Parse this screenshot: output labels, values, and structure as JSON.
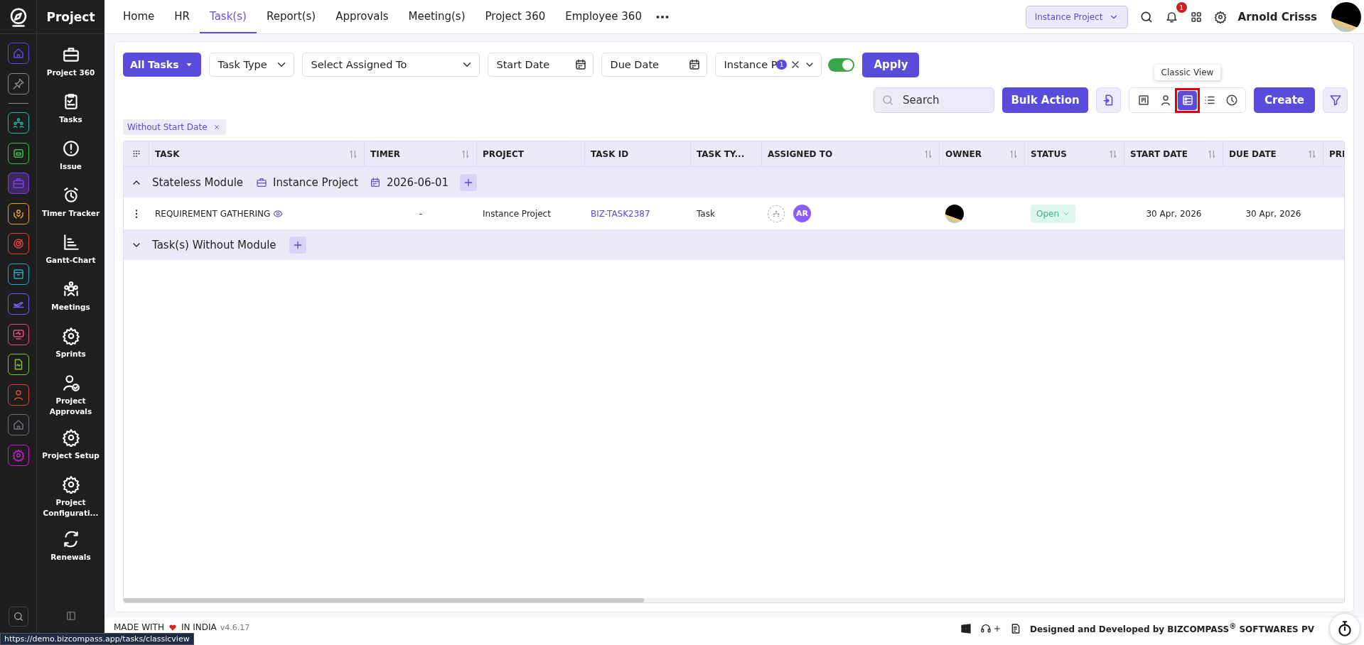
{
  "rail": {
    "items": [
      {
        "color": "#5b4bdb",
        "selected": false
      },
      {
        "color": "#8a8a8a",
        "selected": false
      },
      {
        "color": "#2bb5a5",
        "selected": false
      },
      {
        "color": "#3dbb4a",
        "selected": false
      },
      {
        "color": "#7b3fe4",
        "selected": true
      },
      {
        "color": "#e8a020",
        "selected": false
      },
      {
        "color": "#e0403a",
        "selected": false
      },
      {
        "color": "#2aa8c8",
        "selected": false
      },
      {
        "color": "#7b5cf0",
        "selected": false
      },
      {
        "color": "#e04b7a",
        "selected": false
      },
      {
        "color": "#7cc23a",
        "selected": false
      },
      {
        "color": "#e0453a",
        "selected": false
      },
      {
        "color": "#6a6f80",
        "selected": false
      },
      {
        "color": "#c020c0",
        "selected": false
      }
    ]
  },
  "sidebar": {
    "title": "Project",
    "items": [
      {
        "label": "Project 360"
      },
      {
        "label": "Tasks"
      },
      {
        "label": "Issue"
      },
      {
        "label": "Timer Tracker"
      },
      {
        "label": "Gantt-Chart"
      },
      {
        "label": "Meetings"
      },
      {
        "label": "Sprints"
      },
      {
        "label": "Project Approvals"
      },
      {
        "label": "Project Setup"
      },
      {
        "label": "Project Configurati..."
      },
      {
        "label": "Renewals"
      }
    ]
  },
  "nav": {
    "tabs": [
      {
        "label": "Home",
        "selected": false
      },
      {
        "label": "HR",
        "selected": false
      },
      {
        "label": "Task(s)",
        "selected": true
      },
      {
        "label": "Report(s)",
        "selected": false
      },
      {
        "label": "Approvals",
        "selected": false
      },
      {
        "label": "Meeting(s)",
        "selected": false
      },
      {
        "label": "Project 360",
        "selected": false
      },
      {
        "label": "Employee 360",
        "selected": false
      }
    ],
    "project": "Instance Project",
    "notifications": "1",
    "user": "Arnold Crisss"
  },
  "filters": {
    "all_tasks": "All Tasks",
    "task_type": "Task Type",
    "assigned_to": "Select Assigned To",
    "start_date": "Start Date",
    "due_date": "Due Date",
    "project": "Instance P",
    "project_count": "1",
    "toggle_on": true,
    "apply": "Apply"
  },
  "toolbar": {
    "search": {
      "placeholder": "Search"
    },
    "bulk_action": "Bulk Action",
    "views": [
      {
        "kind": "board",
        "selected": false
      },
      {
        "kind": "user",
        "selected": false
      },
      {
        "kind": "classic",
        "selected": true
      },
      {
        "kind": "list",
        "selected": false
      },
      {
        "kind": "clock",
        "selected": false
      }
    ],
    "tooltip": "Classic View",
    "create": "Create"
  },
  "chips": [
    {
      "label": "Without Start Date"
    }
  ],
  "table": {
    "columns": [
      {
        "label": "TASK",
        "sortable": true
      },
      {
        "label": "TIMER",
        "sortable": true
      },
      {
        "label": "PROJECT",
        "sortable": false
      },
      {
        "label": "TASK ID",
        "sortable": false
      },
      {
        "label": "TASK TY...",
        "sortable": false
      },
      {
        "label": "ASSIGNED TO",
        "sortable": true
      },
      {
        "label": "OWNER",
        "sortable": true
      },
      {
        "label": "STATUS",
        "sortable": true
      },
      {
        "label": "START DATE",
        "sortable": true
      },
      {
        "label": "DUE DATE",
        "sortable": true
      },
      {
        "label": "PRI",
        "sortable": false
      }
    ],
    "groups": [
      {
        "name": "Stateless Module",
        "expanded": true,
        "project": "Instance Project",
        "date": "2026-06-01",
        "rows": [
          {
            "task": "REQUIREMENT GATHERING",
            "timer": "-",
            "project": "Instance Project",
            "task_id": "BIZ-TASK2387",
            "task_type": "Task",
            "assignees": [
              "AR"
            ],
            "status": "Open",
            "start_date": "30 Apr, 2026",
            "due_date": "30 Apr, 2026"
          }
        ]
      },
      {
        "name": "Task(s) Without Module",
        "expanded": false
      }
    ]
  },
  "footer": {
    "made_with": "MADE WITH",
    "made_in": "IN INDIA",
    "version": "v4.6.17",
    "credit": "Designed and Developed by BIZCOMPASS$^{®}$ SOFTWARES PV"
  },
  "status_url": "https://demo.bizcompass.app/tasks/classicview"
}
